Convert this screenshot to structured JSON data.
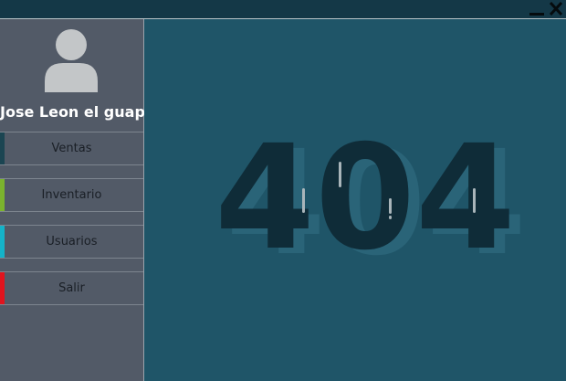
{
  "window": {
    "minimize_icon": "minimize-icon",
    "close_icon": "close-icon"
  },
  "sidebar": {
    "user_name": "Jose Leon el guapo",
    "avatar_icon": "user-avatar-icon",
    "items": [
      {
        "label": "Ventas",
        "accent": "#1b4552"
      },
      {
        "label": "Inventario",
        "accent": "#7bb32e"
      },
      {
        "label": "Usuarios",
        "accent": "#14b3c9"
      },
      {
        "label": "Salir",
        "accent": "#e0141e"
      }
    ]
  },
  "main": {
    "error_code": "404"
  },
  "colors": {
    "titlebar": "#143847",
    "sidebar": "#525a67",
    "main": "#1f5568"
  }
}
